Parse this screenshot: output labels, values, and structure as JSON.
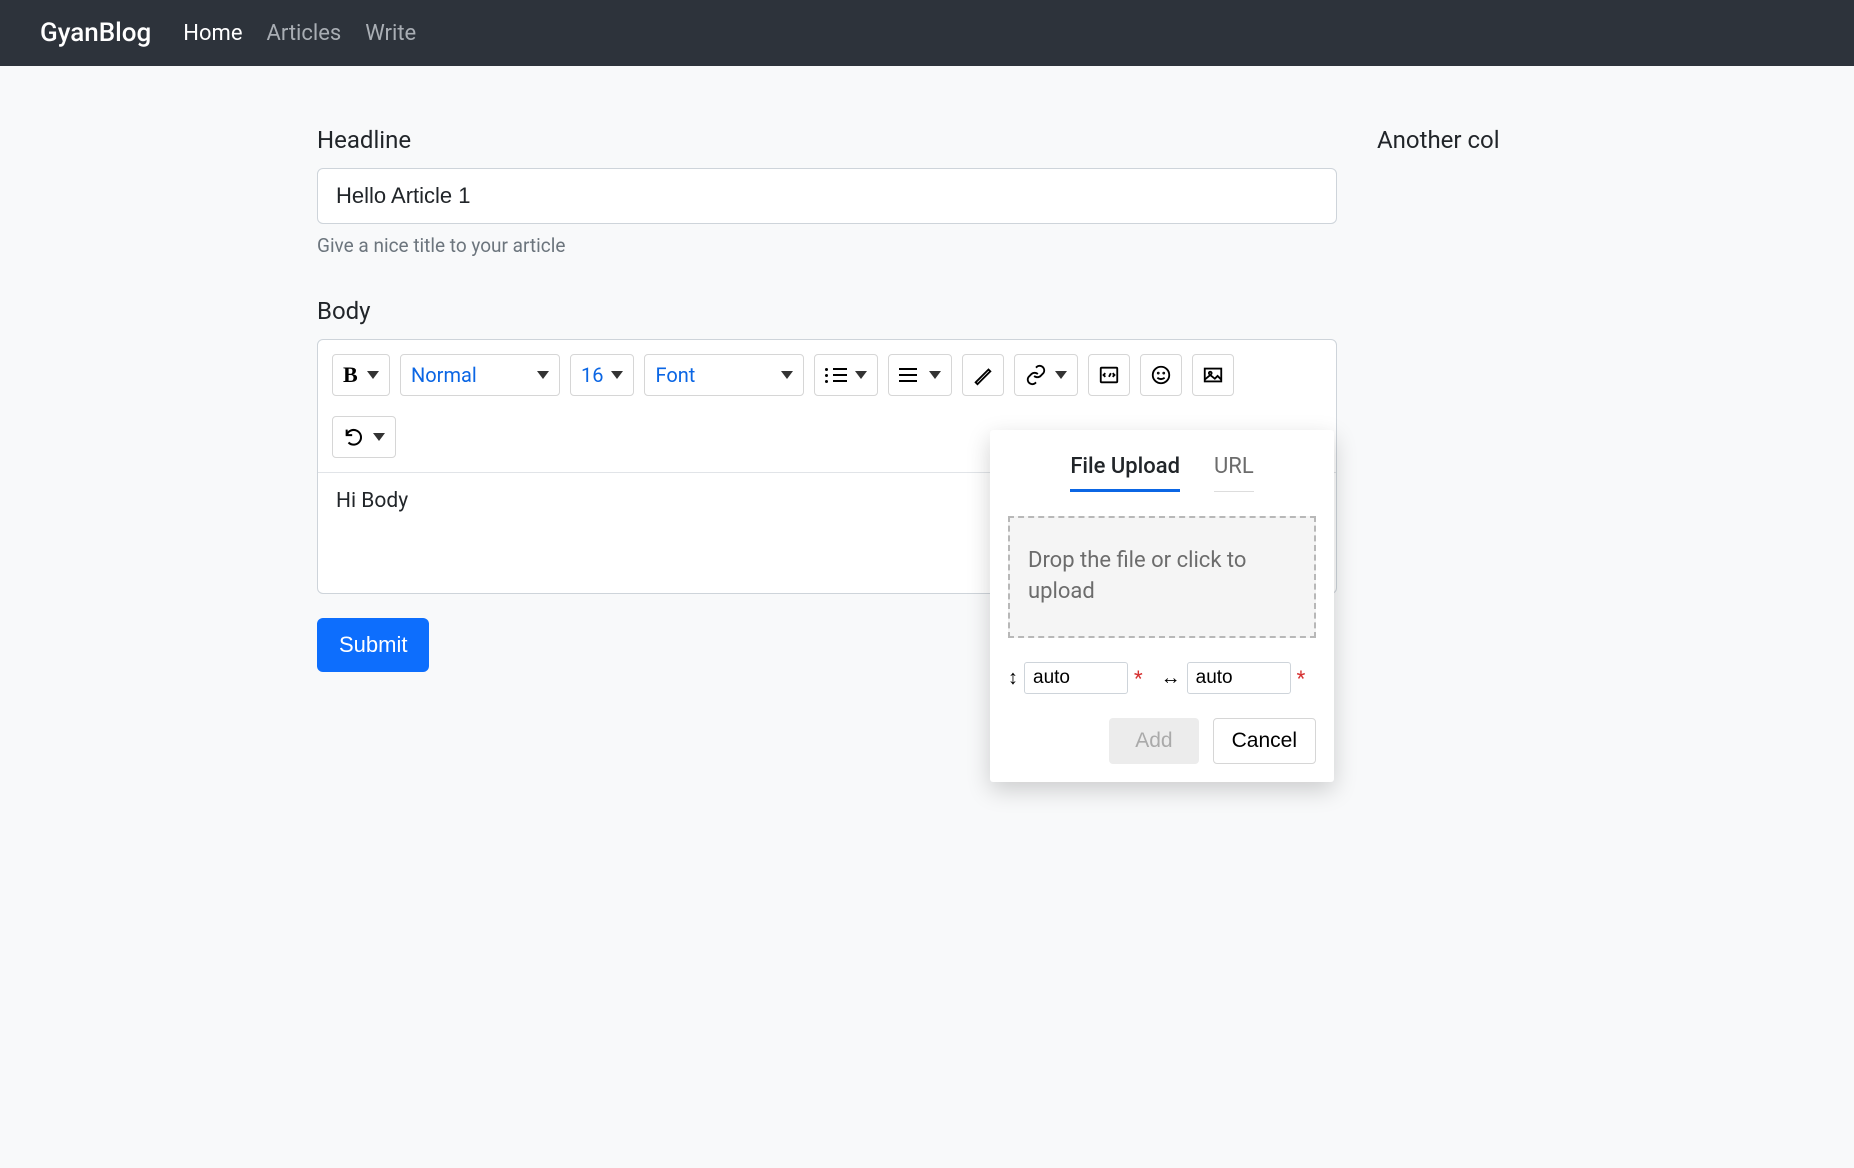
{
  "navbar": {
    "brand": "GyanBlog",
    "links": [
      {
        "label": "Home",
        "active": true
      },
      {
        "label": "Articles",
        "active": false
      },
      {
        "label": "Write",
        "active": false
      }
    ]
  },
  "form": {
    "headline_label": "Headline",
    "headline_value": "Hello Article 1",
    "headline_help": "Give a nice title to your article",
    "body_label": "Body",
    "body_content": "Hi Body",
    "submit_label": "Submit"
  },
  "side": {
    "title": "Another col"
  },
  "toolbar": {
    "style_label": "Normal",
    "size_label": "16",
    "font_label": "Font"
  },
  "popup": {
    "tab_upload": "File Upload",
    "tab_url": "URL",
    "drop_text": "Drop the file or click to upload",
    "height_value": "auto",
    "width_value": "auto",
    "add_label": "Add",
    "cancel_label": "Cancel"
  }
}
